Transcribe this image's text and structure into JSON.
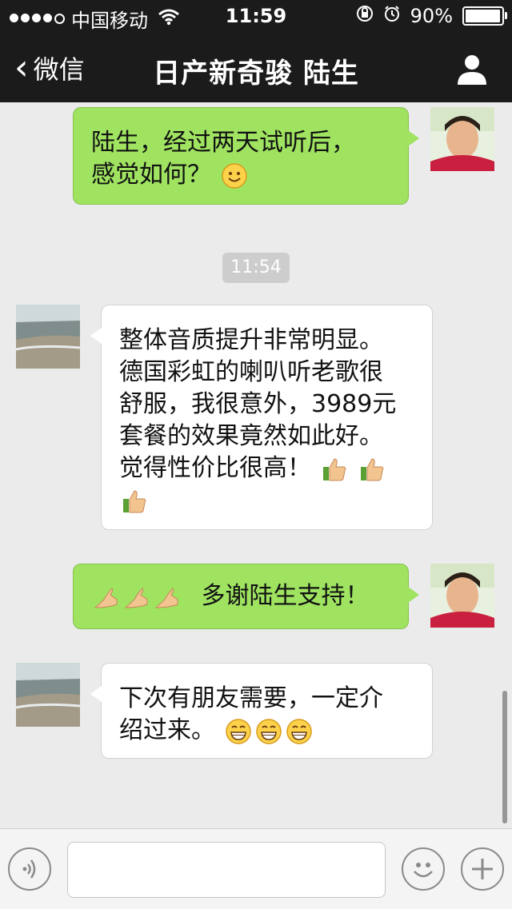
{
  "status_bar": {
    "carrier": "中国移动",
    "time": "11:59",
    "battery": "90%",
    "battery_level": 0.9
  },
  "nav": {
    "back_label": "微信",
    "title": "日产新奇骏 陆生"
  },
  "messages": [
    {
      "side": "right",
      "text_lines": [
        "陆生，经过两天试听后，",
        "感觉如何？"
      ],
      "emoji": [
        "smile-emoji"
      ]
    },
    {
      "timestamp": "11:54"
    },
    {
      "side": "left",
      "text_lines": [
        "整体音质提升非常明显。",
        "德国彩虹的喇叭听老歌很",
        "舒服，我很意外，3989元",
        "套餐的效果竟然如此好。",
        "觉得性价比很高！"
      ],
      "emoji": [
        "thumbs-up-emoji",
        "thumbs-up-emoji",
        "thumbs-up-emoji"
      ]
    },
    {
      "side": "right",
      "text": "多谢陆生支持！",
      "emoji": [
        "pray-hand-emoji",
        "pray-hand-emoji",
        "pray-hand-emoji"
      ]
    },
    {
      "side": "left",
      "text_lines": [
        "下次有朋友需要，一定介",
        "绍过来。"
      ],
      "emoji": [
        "grin-emoji",
        "grin-emoji",
        "grin-emoji"
      ]
    }
  ],
  "colors": {
    "outgoing_bubble": "#9fe361",
    "incoming_bubble": "#ffffff",
    "background": "#ebebeb",
    "header": "#1b1b1b"
  }
}
